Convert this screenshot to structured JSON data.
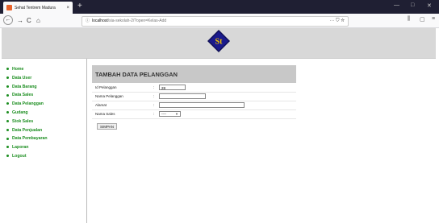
{
  "browser": {
    "tab_title": "Sehat Tentrem Madura",
    "tab_close": "×",
    "new_tab": "+",
    "url_host": "localhost",
    "url_path": "/sia-sekolah-2/?open=Kelas-Add",
    "info_icon": "ⓘ",
    "more_icon": "···",
    "pocket_icon": "⛉",
    "bookmark_icon": "☆",
    "library_icon": "⫼",
    "sidebar_icon": "▢",
    "menu_icon": "≡",
    "back_icon": "←",
    "forward_icon": "→",
    "reload_icon": "C",
    "home_icon": "⌂",
    "minimize": "—",
    "maximize": "□",
    "close": "✕"
  },
  "logo": {
    "text": "St",
    "colors": {
      "fill": "#1a1a8c",
      "text": "#f5c400",
      "border": "#0f0f55"
    }
  },
  "sidebar": {
    "items": [
      {
        "label": "Home"
      },
      {
        "label": "Data User"
      },
      {
        "label": "Data Barang"
      },
      {
        "label": "Data Sales"
      },
      {
        "label": "Data Pelanggan"
      },
      {
        "label": "Gudang"
      },
      {
        "label": "Stok Sales"
      },
      {
        "label": "Data Penjualan"
      },
      {
        "label": "Data Pembayaran"
      },
      {
        "label": "Laporan"
      },
      {
        "label": "Logout"
      }
    ]
  },
  "form": {
    "title": "TAMBAH DATA PELANGGAN",
    "fields": [
      {
        "label": "Id Pelanggan",
        "colon": ":",
        "value": "28"
      },
      {
        "label": "Nama Pelanggan",
        "colon": ":",
        "value": ""
      },
      {
        "label": "Alamat",
        "colon": ":",
        "value": ""
      },
      {
        "label": "Nama Sales",
        "colon": ":",
        "value": "----"
      }
    ],
    "submit_label": "SIMPAN"
  },
  "colors": {
    "menu_green": "#1c8e20",
    "header_gray": "#d8d8d8",
    "form_head": "#c8c8c8"
  }
}
